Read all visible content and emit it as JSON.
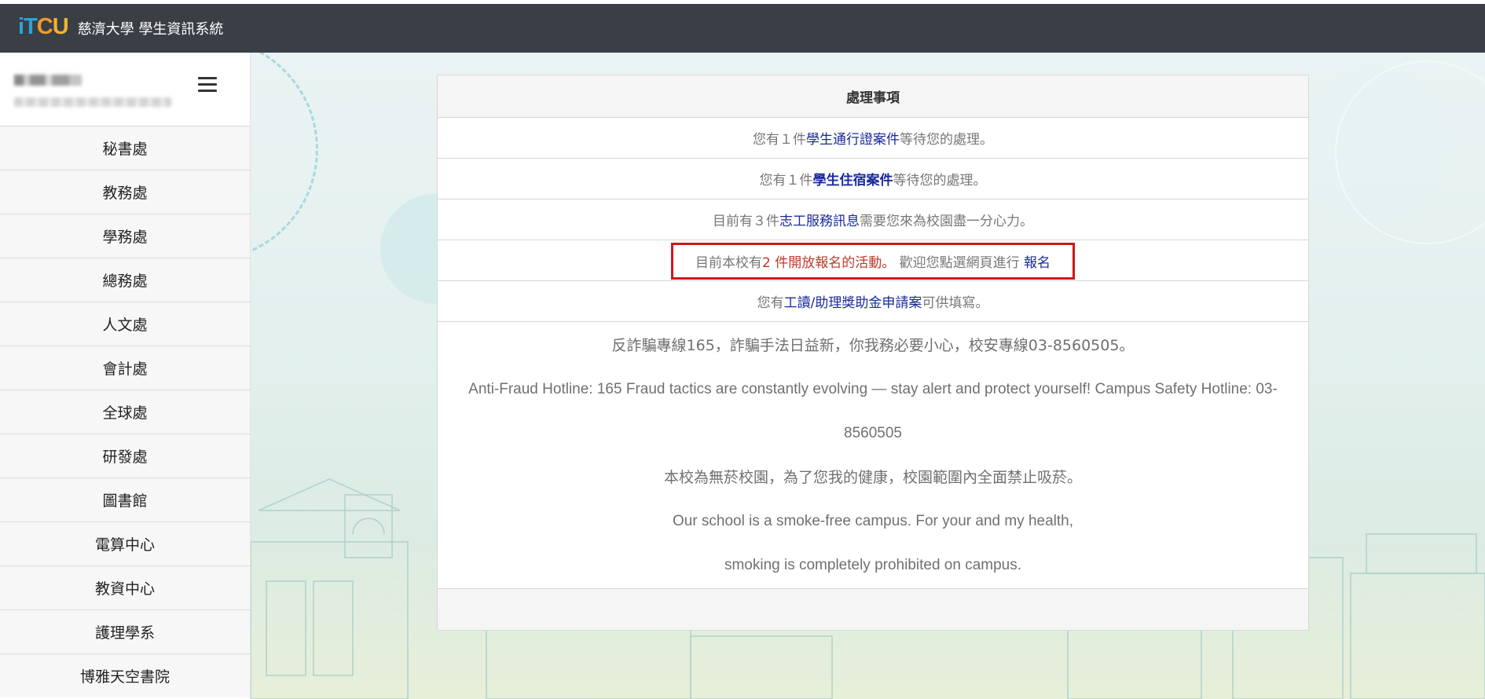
{
  "header": {
    "logo": {
      "i": "i",
      "t": "T",
      "c": "C",
      "u": "U"
    },
    "title": "慈濟大學 學生資訊系統"
  },
  "sidebar": {
    "items": [
      {
        "label": "秘書處"
      },
      {
        "label": "教務處"
      },
      {
        "label": "學務處"
      },
      {
        "label": "總務處"
      },
      {
        "label": "人文處"
      },
      {
        "label": "會計處"
      },
      {
        "label": "全球處"
      },
      {
        "label": "研發處"
      },
      {
        "label": "圖書館"
      },
      {
        "label": "電算中心"
      },
      {
        "label": "教資中心"
      },
      {
        "label": "護理學系"
      },
      {
        "label": "博雅天空書院"
      }
    ]
  },
  "panel": {
    "title": "處理事項",
    "rows": [
      {
        "pre": "您有１件 ",
        "link": "學生通行證案件",
        "post": "等待您的處理。"
      },
      {
        "pre": "您有１件 ",
        "link": "學生住宿案件",
        "post": " 等待您的處理。"
      },
      {
        "pre": "目前有３件 ",
        "link": "志工服務訊息",
        "post": " 需要您來為校園盡一分心力。"
      },
      {
        "pre": "目前本校有",
        "red": "2 件開放報名的活動。",
        "mid": " 歡迎您點選網頁進行 ",
        "link": "報名"
      },
      {
        "pre": "您有 ",
        "link": "工讀/助理獎助金申請案",
        "post": " 可供填寫。"
      }
    ],
    "notices": [
      "反詐騙專線165，詐騙手法日益新，你我務必要小心，校安專線03-8560505。",
      "Anti-Fraud Hotline: 165 Fraud tactics are constantly evolving — stay alert and protect yourself! Campus Safety Hotline: 03-",
      "8560505",
      "本校為無菸校園，為了您我的健康，校園範圍內全面禁止吸菸。",
      "Our school is a smoke-free campus. For your and my health,",
      "smoking is completely prohibited on campus."
    ]
  },
  "colors": {
    "topbar": "#3a3f45",
    "link": "#1a2a9b",
    "highlight_red": "#c0392b",
    "highlight_border": "#d0161b"
  }
}
